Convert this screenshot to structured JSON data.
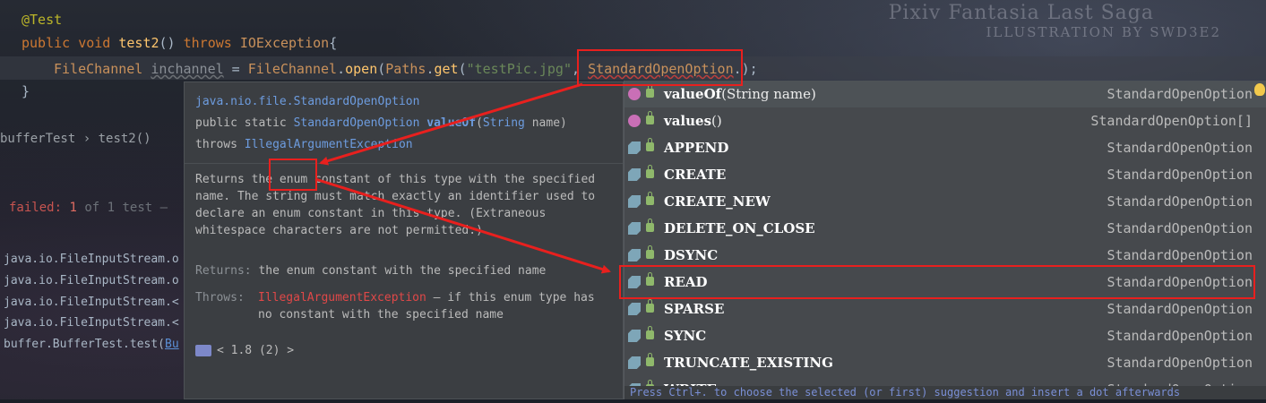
{
  "watermark": {
    "title": "Pixiv Fantasia Last Saga",
    "subtitle": "ILLUSTRATION BY SWD3E2"
  },
  "code": {
    "annotation": "@Test",
    "sig_public": "public ",
    "sig_void": "void ",
    "sig_name": "test2",
    "sig_parens": "() ",
    "sig_throws": "throws ",
    "sig_exc": "IOException",
    "sig_brace": "{",
    "l3_type": "FileChannel",
    "l3_var": "inchannel",
    "l3_eq": " = ",
    "l3_cls": "FileChannel",
    "l3_dot": ".",
    "l3_open": "open",
    "l3_p1": "(",
    "l3_paths": "Paths",
    "l3_dot2": ".",
    "l3_get": "get",
    "l3_p2": "(",
    "l3_str": "\"testPic.jpg\"",
    "l3_p3": ", ",
    "l3_sopt": "StandardOpenOption",
    "l3_dot3": ".",
    "l3_end": ");",
    "close_brace": "}"
  },
  "breadcrumb": {
    "class": "bufferTest",
    "sep": " › ",
    "method": "test2()"
  },
  "test_status": {
    "failed_label": "failed:",
    "failed_count": "1",
    "of_text": " of 1 test –"
  },
  "stack": [
    "java.io.FileInputStream.o",
    "java.io.FileInputStream.o",
    "java.io.FileInputStream.<",
    "java.io.FileInputStream.<",
    "buffer.BufferTest.test("
  ],
  "stack_link": "Bu",
  "doc": {
    "package": "java.nio.file.StandardOpenOption",
    "modifiers": "public static ",
    "return_type": "StandardOpenOption",
    "method": "valueOf",
    "param_type": "String",
    "param_name": " name)",
    "throws_kw": "throws ",
    "throws_type": "IllegalArgumentException",
    "desc_1": "Returns the ",
    "desc_enum": "enum",
    "desc_2": " constant of this type with the specified name. The string must match exactly an identifier used to declare an enum constant in this type. (Extraneous whitespace characters are not permitted.)",
    "returns_label": "Returns:",
    "returns_text": " the enum constant with the specified name",
    "throws_label": "Throws:",
    "throws_exc": "IllegalArgumentException",
    "throws_text": " – if this enum type has no constant with the specified name",
    "footer": "< 1.8 (2) >"
  },
  "completion": {
    "items": [
      {
        "kind": "method",
        "name": "valueOf",
        "args": "(String name)",
        "type": "StandardOpenOption"
      },
      {
        "kind": "method",
        "name": "values",
        "args": "()",
        "type": "StandardOpenOption[]"
      },
      {
        "kind": "field",
        "name": "APPEND",
        "args": "",
        "type": "StandardOpenOption"
      },
      {
        "kind": "field",
        "name": "CREATE",
        "args": "",
        "type": "StandardOpenOption"
      },
      {
        "kind": "field",
        "name": "CREATE_NEW",
        "args": "",
        "type": "StandardOpenOption"
      },
      {
        "kind": "field",
        "name": "DELETE_ON_CLOSE",
        "args": "",
        "type": "StandardOpenOption"
      },
      {
        "kind": "field",
        "name": "DSYNC",
        "args": "",
        "type": "StandardOpenOption"
      },
      {
        "kind": "field",
        "name": "READ",
        "args": "",
        "type": "StandardOpenOption"
      },
      {
        "kind": "field",
        "name": "SPARSE",
        "args": "",
        "type": "StandardOpenOption"
      },
      {
        "kind": "field",
        "name": "SYNC",
        "args": "",
        "type": "StandardOpenOption"
      },
      {
        "kind": "field",
        "name": "TRUNCATE_EXISTING",
        "args": "",
        "type": "StandardOpenOption"
      },
      {
        "kind": "field",
        "name": "WRITE",
        "args": "",
        "type": "StandardOpenOption"
      }
    ],
    "hint": "Press Ctrl+. to choose the selected (or first) suggestion and insert a dot afterwards"
  },
  "colors": {
    "annotation_box": "#e8201e",
    "selection": "#4d5256"
  }
}
